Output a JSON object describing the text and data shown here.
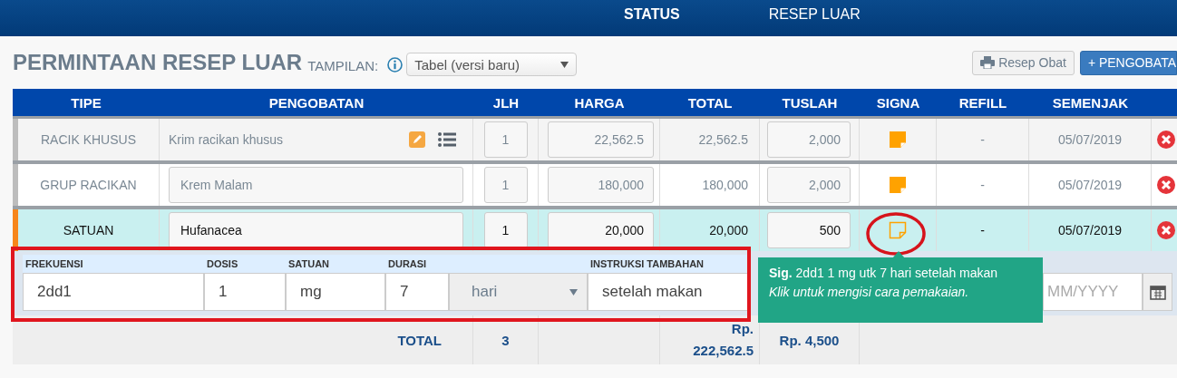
{
  "header": {
    "items": [
      {
        "label": "STATUS",
        "kind": "heading"
      },
      {
        "label": "RESEP LUAR",
        "kind": "value"
      }
    ]
  },
  "title": "PERMINTAAN RESEP LUAR",
  "view_label": "TAMPILAN:",
  "view_select": "Tabel (versi baru)",
  "buttons": [
    {
      "label": "Resep Obat",
      "kind": "print"
    },
    {
      "label": "+ PENGOBATA",
      "kind": "primary"
    }
  ],
  "table": {
    "columns": [
      "TIPE",
      "PENGOBATAN",
      "JLH",
      "HARGA",
      "TOTAL",
      "TUSLAH",
      "SIGNA",
      "REFILL",
      "SEMENJAK"
    ],
    "rows": [
      {
        "type": "RACIK KHUSUS",
        "name": "Krim racikan khusus",
        "kind": "text",
        "qty": "1",
        "price": "22,562.5",
        "total": "22,562.5",
        "tuslah": "2,000",
        "signa_filled": true,
        "refill": "-",
        "since": "05/07/2019",
        "selected": false
      },
      {
        "type": "GRUP RACIKAN",
        "name": "Krem Malam",
        "kind": "field",
        "qty": "1",
        "price": "180,000",
        "total": "180,000",
        "tuslah": "2,000",
        "signa_filled": true,
        "refill": "-",
        "since": "05/07/2019",
        "selected": false
      },
      {
        "type": "SATUAN",
        "name": "Hufanacea",
        "kind": "field",
        "qty": "1",
        "price": "20,000",
        "total": "20,000",
        "tuslah": "500",
        "signa_filled": false,
        "refill": "-",
        "since": "05/07/2019",
        "selected": true
      }
    ],
    "signa_editor": {
      "fields": [
        {
          "label": "FREKUENSI",
          "parts": [
            {
              "kind": "input",
              "value": "2dd1"
            }
          ]
        },
        {
          "label": "DOSIS",
          "parts": [
            {
              "kind": "input",
              "value": "1"
            }
          ]
        },
        {
          "label": "SATUAN",
          "parts": [
            {
              "kind": "input",
              "value": "mg"
            }
          ]
        },
        {
          "label": "DURASI",
          "parts": [
            {
              "kind": "input",
              "value": "7"
            },
            {
              "kind": "select",
              "value": "hari"
            }
          ]
        },
        {
          "label": "INSTRUKSI TAMBAHAN",
          "parts": [
            {
              "kind": "input",
              "value": "setelah makan"
            }
          ]
        }
      ],
      "date_placeholder": "MM/YYYY"
    },
    "totals": {
      "label": "TOTAL",
      "qty": "3",
      "total": "Rp. 222,562.5",
      "tuslah": "Rp. 4,500"
    }
  },
  "tooltip": {
    "text": "**Sig.** 2dd1 1 mg utk 7 hari setelah makan",
    "hint": "Klik untuk mengisi cara pemakaian."
  }
}
